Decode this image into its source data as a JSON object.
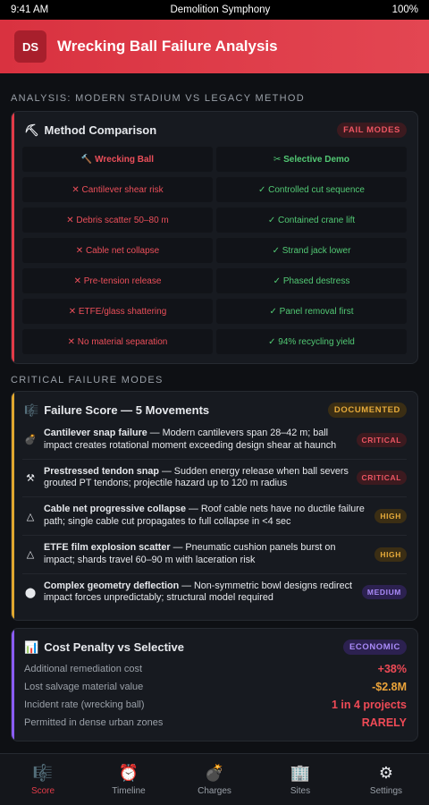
{
  "status_bar": {
    "time": "9:41 AM",
    "title": "Demolition Symphony",
    "battery": "100%"
  },
  "header": {
    "logo": "DS",
    "title": "Wrecking Ball Failure Analysis"
  },
  "comparison": {
    "section_label": "ANALYSIS: MODERN STADIUM VS LEGACY METHOD",
    "card_icon": "⛏",
    "card_title": "Method Comparison",
    "badge": "FAIL MODES",
    "left_head": "🔨 Wrecking Ball",
    "right_head": "✂ Selective Demo",
    "rows": [
      {
        "bad": "✕ Cantilever shear risk",
        "good": "✓ Controlled cut sequence"
      },
      {
        "bad": "✕ Debris scatter 50–80 m",
        "good": "✓ Contained crane lift"
      },
      {
        "bad": "✕ Cable net collapse",
        "good": "✓ Strand jack lower"
      },
      {
        "bad": "✕ Pre-tension release",
        "good": "✓ Phased destress"
      },
      {
        "bad": "✕ ETFE/glass shattering",
        "good": "✓ Panel removal first"
      },
      {
        "bad": "✕ No material separation",
        "good": "✓ 94% recycling yield"
      }
    ]
  },
  "failures": {
    "section_label": "CRITICAL FAILURE MODES",
    "card_icon": "🎼",
    "card_title": "Failure Score — 5 Movements",
    "badge": "DOCUMENTED",
    "items": [
      {
        "icon": "💣",
        "title": "Cantilever snap failure",
        "desc": " — Modern cantilevers span 28–42 m; ball impact creates rotational moment exceeding design shear at haunch",
        "severity": "CRITICAL"
      },
      {
        "icon": "⚒",
        "title": "Prestressed tendon snap",
        "desc": " — Sudden energy release when ball severs grouted PT tendons; projectile hazard up to 120 m radius",
        "severity": "CRITICAL"
      },
      {
        "icon": "△",
        "title": "Cable net progressive collapse",
        "desc": " — Roof cable nets have no ductile failure path; single cable cut propagates to full collapse in <4 sec",
        "severity": "HIGH"
      },
      {
        "icon": "△",
        "title": "ETFE film explosion scatter",
        "desc": " — Pneumatic cushion panels burst on impact; shards travel 60–90 m with laceration risk",
        "severity": "HIGH"
      },
      {
        "icon": "⬤",
        "title": "Complex geometry deflection",
        "desc": " — Non-symmetric bowl designs redirect impact forces unpredictably; structural model required",
        "severity": "MEDIUM"
      }
    ]
  },
  "cost": {
    "card_icon": "📊",
    "card_title": "Cost Penalty vs Selective",
    "badge": "ECONOMIC",
    "rows": [
      {
        "label": "Additional remediation cost",
        "value": "+38%",
        "color": "#ef4a56"
      },
      {
        "label": "Lost salvage material value",
        "value": "-$2.8M",
        "color": "#eba33a"
      },
      {
        "label": "Incident rate (wrecking ball)",
        "value": "1 in 4 projects",
        "color": "#ef4a56"
      },
      {
        "label": "Permitted in dense urban zones",
        "value": "RARELY",
        "color": "#ef4a56"
      }
    ]
  },
  "tabs": [
    {
      "icon": "🎼",
      "label": "Score",
      "active": true
    },
    {
      "icon": "⏰",
      "label": "Timeline"
    },
    {
      "icon": "💣",
      "label": "Charges"
    },
    {
      "icon": "🏢",
      "label": "Sites"
    },
    {
      "icon": "⚙",
      "label": "Settings"
    }
  ],
  "colors": {
    "accent": "#e23b48",
    "good": "#52c974",
    "warning": "#e6aa3a",
    "economic": "#8a5cf6"
  }
}
